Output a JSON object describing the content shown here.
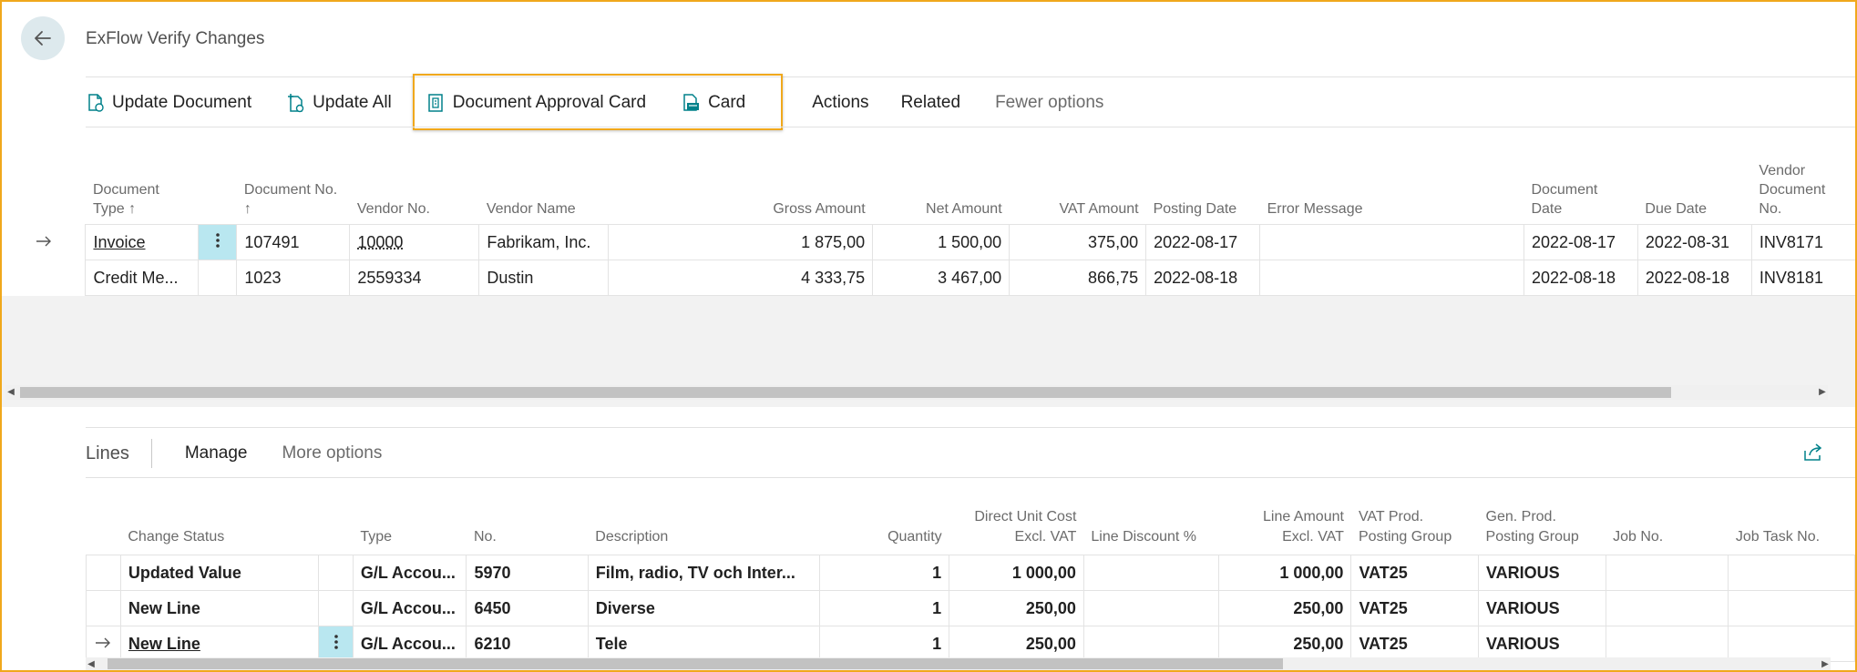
{
  "page": {
    "title": "ExFlow Verify Changes"
  },
  "commands": {
    "update_document": "Update Document",
    "update_all": "Update All",
    "document_approval_card": "Document Approval Card",
    "card": "Card",
    "actions": "Actions",
    "related": "Related",
    "fewer_options": "Fewer options"
  },
  "header_grid": {
    "columns": {
      "document_type": "Document Type ↑",
      "document_no": "Document No. ↑",
      "vendor_no": "Vendor No.",
      "vendor_name": "Vendor Name",
      "gross_amount": "Gross Amount",
      "net_amount": "Net Amount",
      "vat_amount": "VAT Amount",
      "posting_date": "Posting Date",
      "error_message": "Error Message",
      "document_date": "Document Date",
      "due_date": "Due Date",
      "vendor_document_no": "Vendor Document No."
    },
    "rows": [
      {
        "document_type": "Invoice",
        "document_no": "107491",
        "vendor_no": "10000",
        "vendor_name": "Fabrikam, Inc.",
        "gross_amount": "1 875,00",
        "net_amount": "1 500,00",
        "vat_amount": "375,00",
        "posting_date": "2022-08-17",
        "error_message": "",
        "document_date": "2022-08-17",
        "due_date": "2022-08-31",
        "vendor_document_no": "INV8171"
      },
      {
        "document_type": "Credit Me...",
        "document_no": "1023",
        "vendor_no": "2559334",
        "vendor_name": "Dustin",
        "gross_amount": "4 333,75",
        "net_amount": "3 467,00",
        "vat_amount": "866,75",
        "posting_date": "2022-08-18",
        "error_message": "",
        "document_date": "2022-08-18",
        "due_date": "2022-08-18",
        "vendor_document_no": "INV8181"
      }
    ]
  },
  "lines": {
    "title": "Lines",
    "manage": "Manage",
    "more_options": "More options",
    "columns": {
      "change_status": "Change Status",
      "type": "Type",
      "no": "No.",
      "description": "Description",
      "quantity": "Quantity",
      "direct_unit_cost_1": "Direct Unit Cost",
      "direct_unit_cost_2": "Excl. VAT",
      "line_discount": "Line Discount %",
      "line_amount_1": "Line Amount",
      "line_amount_2": "Excl. VAT",
      "vat_prod_1": "VAT Prod.",
      "vat_prod_2": "Posting Group",
      "gen_prod_1": "Gen. Prod.",
      "gen_prod_2": "Posting Group",
      "job_no": "Job No.",
      "job_task_no": "Job Task No."
    },
    "rows": [
      {
        "change_status": "Updated Value",
        "type": "G/L Accou...",
        "no": "5970",
        "description": "Film, radio, TV och Inter...",
        "quantity": "1",
        "direct_unit_cost": "1 000,00",
        "line_discount": "",
        "line_amount": "1 000,00",
        "vat_prod": "VAT25",
        "gen_prod": "VARIOUS",
        "job_no": "",
        "job_task_no": ""
      },
      {
        "change_status": "New Line",
        "type": "G/L Accou...",
        "no": "6450",
        "description": "Diverse",
        "quantity": "1",
        "direct_unit_cost": "250,00",
        "line_discount": "",
        "line_amount": "250,00",
        "vat_prod": "VAT25",
        "gen_prod": "VARIOUS",
        "job_no": "",
        "job_task_no": ""
      },
      {
        "change_status": "New Line",
        "type": "G/L Accou...",
        "no": "6210",
        "description": "Tele",
        "quantity": "1",
        "direct_unit_cost": "250,00",
        "line_discount": "",
        "line_amount": "250,00",
        "vat_prod": "VAT25",
        "gen_prod": "VARIOUS",
        "job_no": "",
        "job_task_no": ""
      }
    ]
  },
  "colors": {
    "highlight": "#f0a81c",
    "selected_cell": "#b9e7f0",
    "back_button": "#dde9ed",
    "accent": "#00818a"
  },
  "icons": [
    "back-arrow-icon",
    "update-document-icon",
    "update-all-icon",
    "document-approval-card-icon",
    "card-icon",
    "row-arrow-icon",
    "more-dots-icon",
    "share-icon"
  ]
}
